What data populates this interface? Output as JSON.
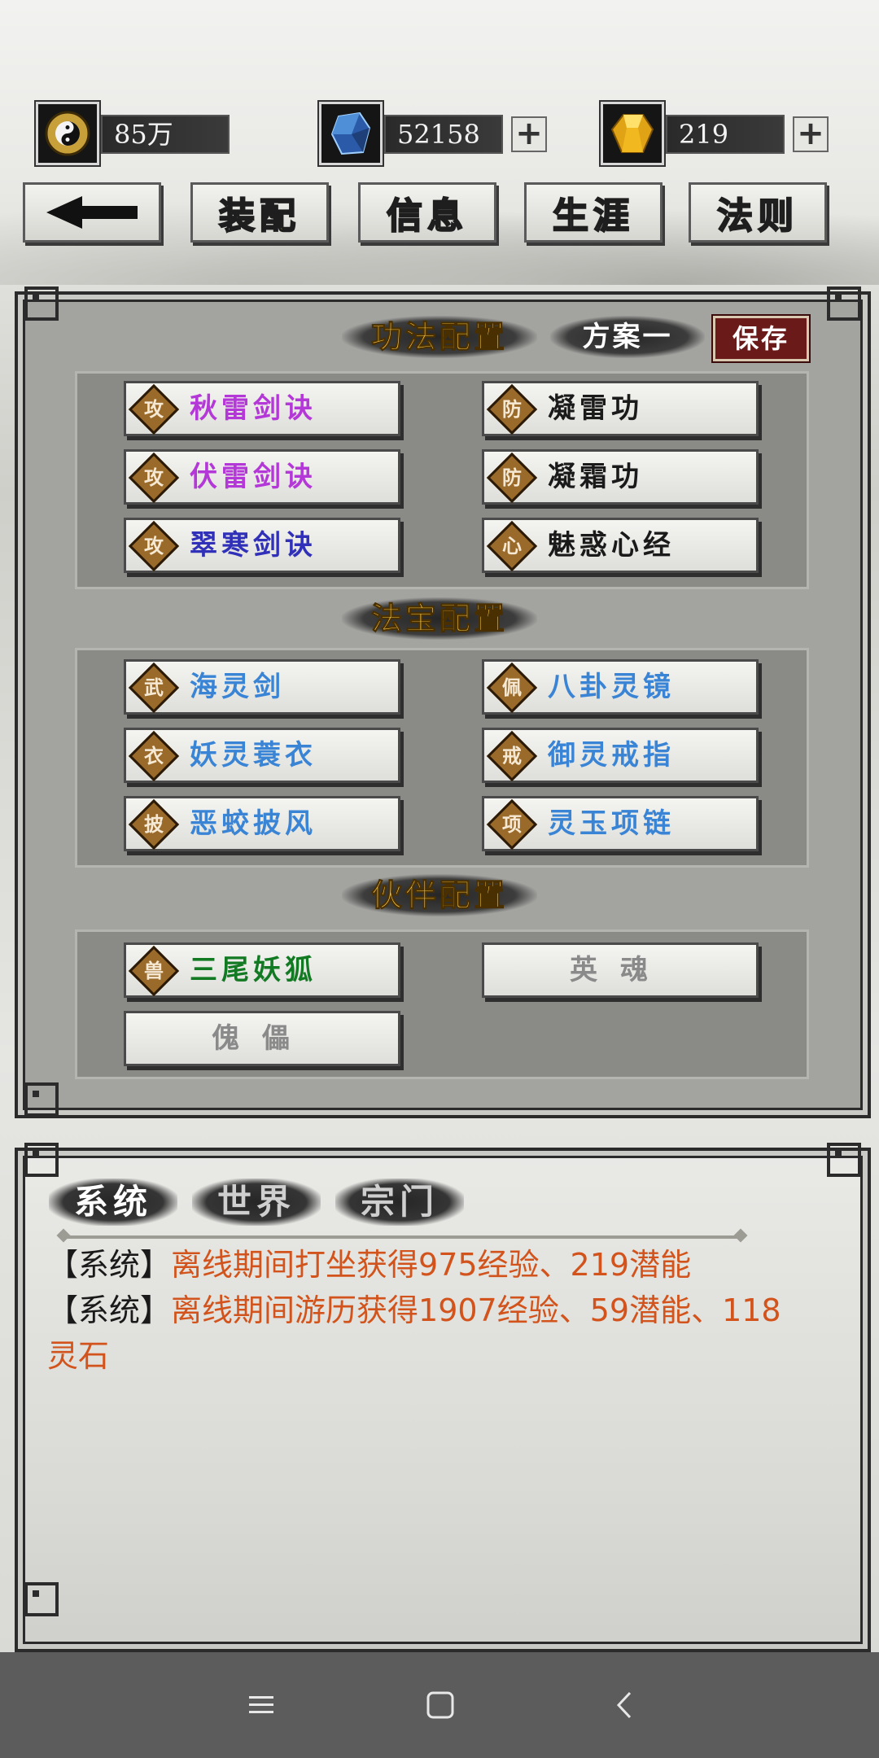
{
  "resources": [
    {
      "icon": "yin-yang-icon",
      "value": "85万",
      "has_plus": false
    },
    {
      "icon": "blue-crystal-icon",
      "value": "52158",
      "has_plus": true
    },
    {
      "icon": "gold-gem-icon",
      "value": "219",
      "has_plus": true
    }
  ],
  "nav": {
    "back_icon": "back-arrow-icon",
    "tabs": [
      {
        "label": "装配",
        "active": true
      },
      {
        "label": "信息",
        "active": false
      },
      {
        "label": "生涯",
        "active": false
      },
      {
        "label": "法则",
        "active": false
      }
    ]
  },
  "skills": {
    "title": "功法配置",
    "scheme": "方案一",
    "save_label": "保存",
    "slots": [
      {
        "tag": "攻",
        "name": "秋雷剑诀",
        "color": "#b437d8"
      },
      {
        "tag": "防",
        "name": "凝雷功",
        "color": "#1a1a1a"
      },
      {
        "tag": "攻",
        "name": "伏雷剑诀",
        "color": "#b437d8"
      },
      {
        "tag": "防",
        "name": "凝霜功",
        "color": "#1a1a1a"
      },
      {
        "tag": "攻",
        "name": "翠寒剑诀",
        "color": "#3030b8"
      },
      {
        "tag": "心",
        "name": "魅惑心经",
        "color": "#1a1a1a"
      }
    ]
  },
  "treasures": {
    "title": "法宝配置",
    "slots": [
      {
        "tag": "武",
        "name": "海灵剑",
        "color": "#3a84d6"
      },
      {
        "tag": "佩",
        "name": "八卦灵镜",
        "color": "#3a84d6"
      },
      {
        "tag": "衣",
        "name": "妖灵蓑衣",
        "color": "#3a84d6"
      },
      {
        "tag": "戒",
        "name": "御灵戒指",
        "color": "#3a84d6"
      },
      {
        "tag": "披",
        "name": "恶蛟披风",
        "color": "#3a84d6"
      },
      {
        "tag": "项",
        "name": "灵玉项链",
        "color": "#3a84d6"
      }
    ]
  },
  "partners": {
    "title": "伙伴配置",
    "slots": [
      {
        "tag": "兽",
        "name": "三尾妖狐",
        "color": "#137a24",
        "empty": false
      },
      {
        "tag": "",
        "name": "英魂",
        "empty": true
      },
      {
        "tag": "",
        "name": "傀儡",
        "empty": true
      }
    ]
  },
  "chat": {
    "tabs": [
      "系统",
      "世界",
      "宗门"
    ],
    "messages": [
      {
        "who": "【系统】",
        "text": "离线期间打坐获得975经验、219潜能"
      },
      {
        "who": "【系统】",
        "text": "离线期间游历获得1907经验、59潜能、118灵石"
      }
    ]
  },
  "system_nav": [
    "menu-icon",
    "home-icon",
    "back-icon"
  ]
}
